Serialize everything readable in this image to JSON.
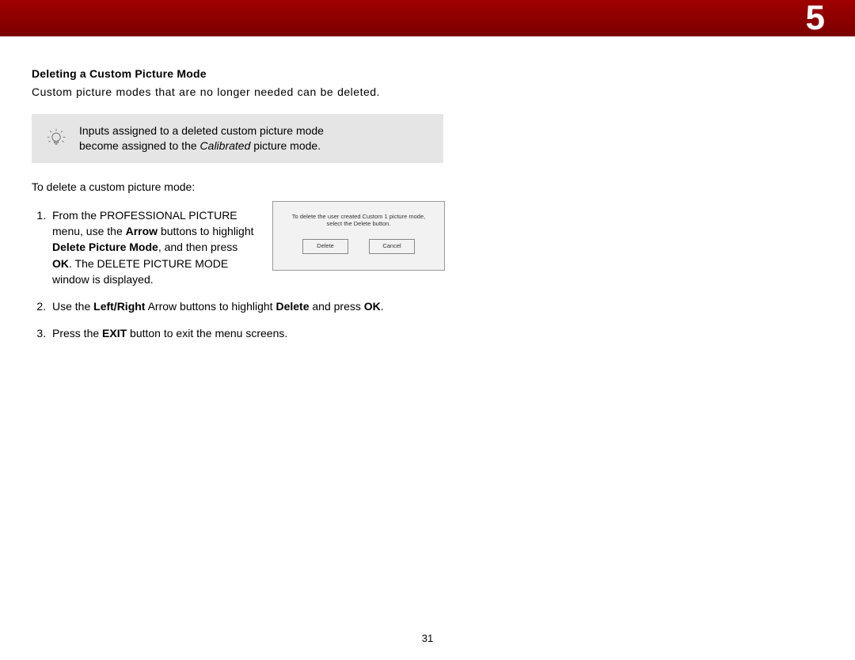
{
  "chapter_number": "5",
  "page_number": "31",
  "section": {
    "heading": "Deleting a Custom Picture Mode",
    "intro": "Custom picture modes that are no longer needed can be deleted."
  },
  "tip": {
    "line1": "Inputs assigned to a deleted custom picture mode",
    "line2_before": "become assigned to the ",
    "line2_italic": "Calibrated",
    "line2_after": " picture mode."
  },
  "steps_intro": "To delete a custom picture mode:",
  "step1": {
    "seg1": "From the PROFESSIONAL PICTURE menu, use the ",
    "bold1": "Arrow",
    "seg2": " buttons to highlight ",
    "bold2": "Delete Picture Mode",
    "seg3": ", and then press ",
    "bold3": "OK",
    "seg4": ". The DELETE PICTURE MODE window is displayed."
  },
  "step2": {
    "seg1": "Use the ",
    "bold1": "Left/Right",
    "seg2": " Arrow buttons to highlight ",
    "bold2": "Delete",
    "seg3": " and press ",
    "bold3": "OK",
    "seg4": "."
  },
  "step3": {
    "seg1": "Press the ",
    "bold1": "EXIT",
    "seg2": " button to exit the menu screens."
  },
  "dialog": {
    "message_line1": "To delete the user created Custom 1 picture mode,",
    "message_line2": "select the Delete button.",
    "delete_label": "Delete",
    "cancel_label": "Cancel"
  }
}
